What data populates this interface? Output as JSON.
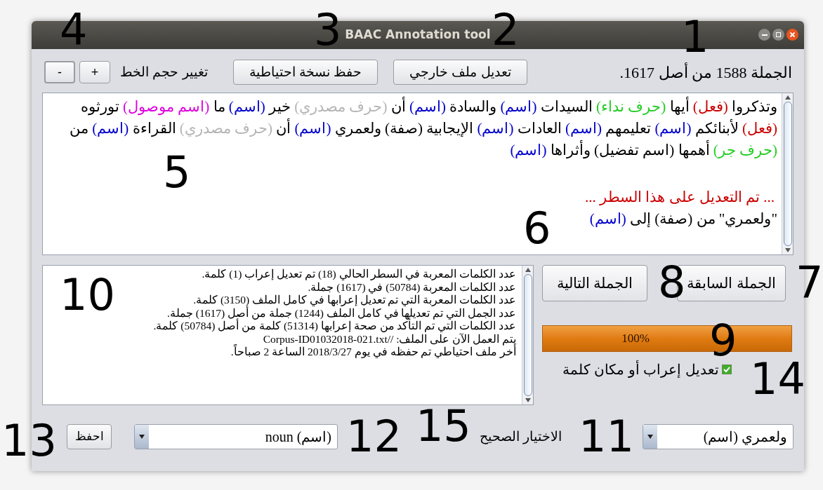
{
  "window": {
    "title": "BAAC Annotation tool"
  },
  "toolbar": {
    "sentence_counter": "الجملة 1588 من أصل 1617.",
    "edit_external_button": "تعديل ملف خارجي",
    "backup_button": "حفظ نسخة احتياطية",
    "font_size_label": "تغيير حجم الخط",
    "increase_button": "+",
    "decrease_button": "-"
  },
  "sentence": {
    "tokens": [
      {
        "word": "وتذكروا",
        "tag": "(فعل)",
        "color": "#cc0000"
      },
      {
        "word": "أيها",
        "tag": "(حرف نداء)",
        "color": "#22cc22"
      },
      {
        "word": "السيدات",
        "tag": "(اسم)",
        "color": "#0000cc"
      },
      {
        "word": "والسادة",
        "tag": "(اسم)",
        "color": "#0000cc"
      },
      {
        "word": "أن",
        "tag": "(حرف مصدري)",
        "color": "#b4b4b4"
      },
      {
        "word": "خير",
        "tag": "(اسم)",
        "color": "#0000cc"
      },
      {
        "word": "ما",
        "tag": "(اسم موصول)",
        "color": "#dd00dd"
      },
      {
        "word": "تورثوه",
        "tag": "(فعل)",
        "color": "#cc0000"
      },
      {
        "word": "لأبنائكم",
        "tag": "(اسم)",
        "color": "#0000cc"
      },
      {
        "word": "تعليمهم",
        "tag": "(اسم)",
        "color": "#0000cc"
      },
      {
        "word": "العادات",
        "tag": "(اسم)",
        "color": "#0000cc"
      },
      {
        "word": "الإيجابية",
        "tag": "(صفة)",
        "color": "#000000"
      },
      {
        "word": "ولعمري",
        "tag": "(اسم)",
        "color": "#0000cc"
      },
      {
        "word": "أن",
        "tag": "(حرف مصدري)",
        "color": "#b4b4b4"
      },
      {
        "word": "القراءة",
        "tag": "(اسم)",
        "color": "#0000cc"
      },
      {
        "word": "من",
        "tag": "(حرف جر)",
        "color": "#22cc22"
      },
      {
        "word": "أهمها",
        "tag": "(اسم تفضيل)",
        "color": "#000000"
      },
      {
        "word": "وأثراها",
        "tag": "(اسم)",
        "color": "#0000cc"
      }
    ],
    "edit_notice": {
      "text": "... تم التعديل على هذا السطر ...",
      "color": "#cc0000"
    },
    "edit_detail": [
      {
        "text": "\"ولعمري\" من (صفة) إلى",
        "color": "#000000"
      },
      {
        "text": "(اسم)",
        "color": "#0000cc"
      }
    ]
  },
  "stats": [
    "عدد الكلمات المعربة في السطر الحالي (18) تم تعديل إعراب (1) كلمة.",
    "عدد الكلمات المعربة (50784) في (1617) جملة.",
    "عدد الكلمات المعربة التي تم تعديل إعرابها في كامل الملف (3150) كلمة.",
    "عدد الجمل التي تم تعديلها في كامل الملف (1244) جملة من أصل (1617) جملة.",
    "عدد الكلمات التي تم التأكد من صحة إعرابها  (51314) كلمة من أصل (50784) كلمة.",
    "يتم العمل الآن على الملف: //Corpus-ID01032018-021.txt",
    "أخر ملف احتياطي تم حفظه في يوم 2018/3/27 الساعة 2 صباحاً."
  ],
  "navigation": {
    "previous_button": "الجملة السابقة",
    "next_button": "الجملة التالية"
  },
  "progress": {
    "level": 1,
    "reading": "100%"
  },
  "edit_checkbox": {
    "label": "تعديل إعراب أو مكان كلمة",
    "checked": true
  },
  "bottom": {
    "word_combo": "ولعمري (اسم)",
    "correct_label": "الاختيار الصحيح",
    "tag_combo": "(اسم) noun",
    "save_button": "احفظ"
  },
  "callouts": [
    "1",
    "2",
    "3",
    "4",
    "5",
    "6",
    "7",
    "8",
    "9",
    "10",
    "11",
    "12",
    "13",
    "14",
    "15"
  ]
}
